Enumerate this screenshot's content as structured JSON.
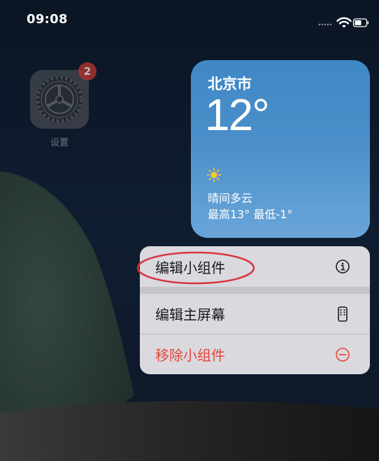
{
  "status_bar": {
    "time": "09:08",
    "icons": [
      "signal-dots-icon",
      "wifi-icon",
      "battery-icon"
    ]
  },
  "home_screen": {
    "apps": [
      {
        "label": "设置",
        "icon": "gear-icon",
        "badge": "2"
      }
    ]
  },
  "weather_widget": {
    "city": "北京市",
    "temperature": "12°",
    "condition_icon": "sun-icon",
    "condition": "晴间多云",
    "high_low": "最高13° 最低-1°"
  },
  "context_menu": {
    "items": [
      {
        "label": "编辑小组件",
        "icon": "info-icon"
      },
      {
        "label": "编辑主屏幕",
        "icon": "phone-icon"
      },
      {
        "label": "移除小组件",
        "icon": "minus-circle-icon",
        "destructive": true
      }
    ]
  },
  "colors": {
    "widget_blue": "#4a8fca",
    "destructive_red": "#e5453c",
    "menu_background": "#d9d9de",
    "annotation_red": "#d9363e"
  }
}
